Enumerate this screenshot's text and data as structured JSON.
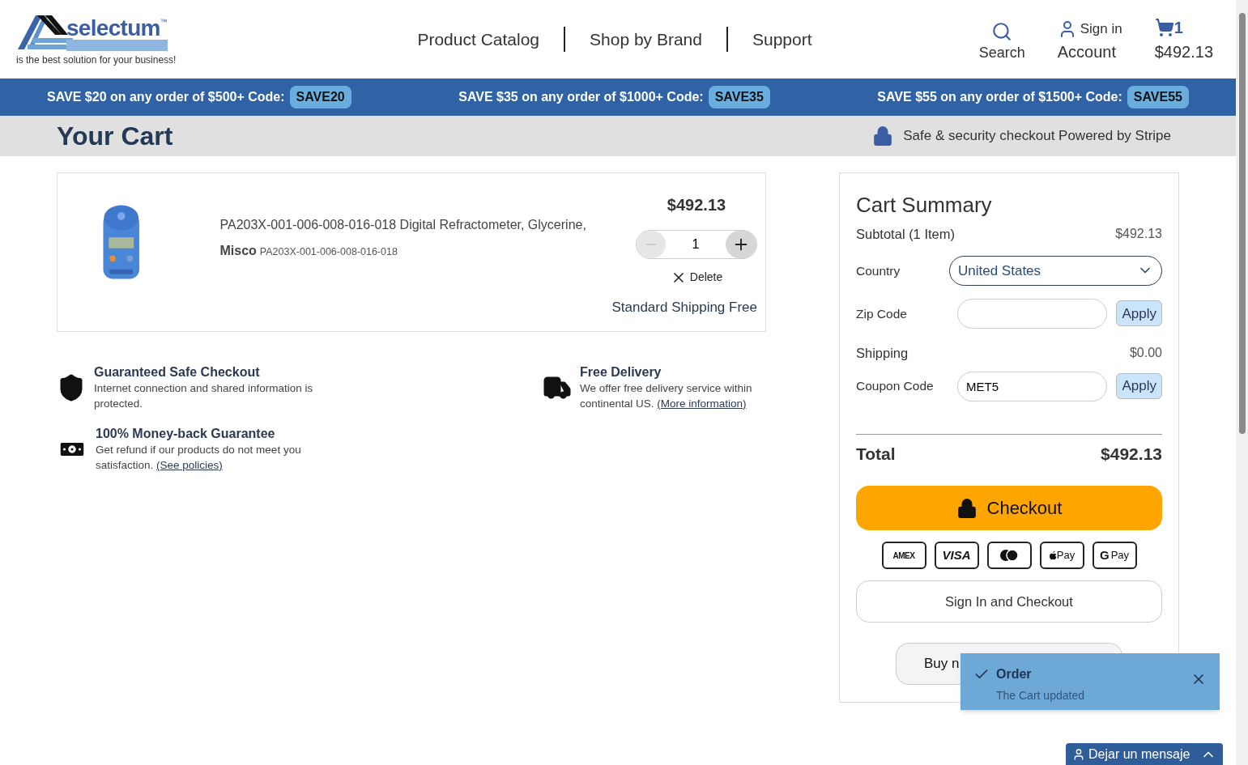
{
  "header": {
    "logo": {
      "name": "selectum",
      "trademark": "™",
      "tagline": "is the best solution for your business!"
    },
    "nav": [
      "Product Catalog",
      "Shop by Brand",
      "Support"
    ],
    "search": {
      "label": "Search"
    },
    "account": {
      "top": "Sign in",
      "label": "Account"
    },
    "cart": {
      "count": "1",
      "total": "$492.13"
    }
  },
  "promos": [
    {
      "text": "SAVE $20 on any order of $500+ Code:",
      "code": "SAVE20"
    },
    {
      "text": "SAVE $35 on any order of $1000+ Code:",
      "code": "SAVE35"
    },
    {
      "text": "SAVE $55 on any order of $1500+ Code:",
      "code": "SAVE55"
    }
  ],
  "page_title": "Your Cart",
  "secure_note": "Safe & security checkout Powered by Stripe",
  "cart_items": [
    {
      "name": "PA203X-001-006-008-016-018 Digital Refractometer, Glycerine,",
      "brand": "Misco",
      "sku": "PA203X-001-006-008-016-018",
      "price": "$492.13",
      "quantity": "1",
      "delete": "Delete",
      "shipping": "Standard Shipping Free"
    }
  ],
  "features": [
    {
      "kind": "shield",
      "title": "Guaranteed Safe Checkout",
      "text": "Internet connection and shared information is protected."
    },
    {
      "kind": "truck",
      "title": "Free Delivery",
      "text": "We offer free delivery service within continental US.",
      "link": "(More information)"
    },
    {
      "kind": "money",
      "title": "100% Money-back Guarantee",
      "text": "Get refund if our products do not meet you satisfaction.",
      "link": "(See policies)"
    }
  ],
  "summary": {
    "title": "Cart Summary",
    "subtotal": {
      "label": "Subtotal (1 Item)",
      "value": "$492.13"
    },
    "country": {
      "label": "Country",
      "value": "United States"
    },
    "zip": {
      "label": "Zip Code",
      "button": "Apply"
    },
    "shipping": {
      "label": "Shipping",
      "value": "$0.00"
    },
    "coupon": {
      "label": "Coupon Code",
      "value": "MET5",
      "button": "Apply"
    },
    "total": {
      "label": "Total",
      "value": "$492.13"
    },
    "checkout": "Checkout",
    "payment_methods": [
      {
        "kind": "amex",
        "label": "AMEX"
      },
      {
        "kind": "visa",
        "label": "VISA"
      },
      {
        "kind": "mastercard"
      },
      {
        "kind": "apple",
        "label": "Pay"
      },
      {
        "kind": "google",
        "mark": "G",
        "label": "Pay"
      }
    ],
    "sign_in_checkout": "Sign In and Checkout",
    "paypal": {
      "text": "Buy n"
    }
  },
  "toast": {
    "title": "Order",
    "message": "The Cart updated"
  },
  "chat": {
    "label": "Dejar un mensaje"
  }
}
